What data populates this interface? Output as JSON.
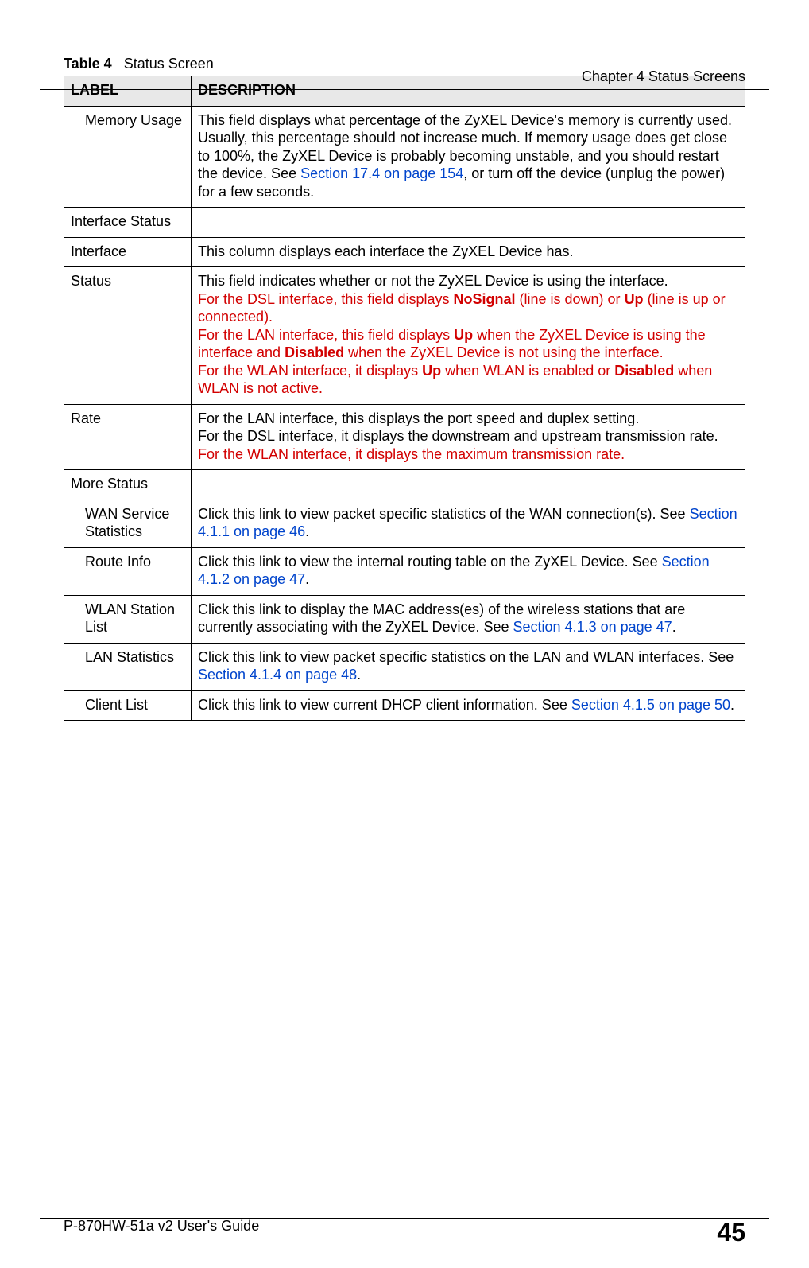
{
  "running_head": "Chapter 4 Status Screens",
  "caption_prefix": "Table 4",
  "caption_title": "Status Screen",
  "header_label": "LABEL",
  "header_desc": "DESCRIPTION",
  "rows": {
    "memory_usage": {
      "label": "Memory Usage",
      "d1": "This field displays what percentage of the ZyXEL Device's memory is currently used. Usually, this percentage should not increase much. If memory usage does get close to 100%, the ZyXEL Device is probably becoming unstable, and you should restart the device. See ",
      "link": "Section 17.4 on page 154",
      "d2": ", or turn off the device (unplug the power) for a few seconds."
    },
    "interface_status": {
      "label": "Interface Status"
    },
    "interface": {
      "label": "Interface",
      "d1": "This column displays each interface the ZyXEL Device has."
    },
    "status": {
      "label": "Status",
      "d1": "This field indicates whether or not the ZyXEL Device is using the interface.",
      "r1a": "For the DSL interface, this field displays ",
      "r1b": "NoSignal",
      "r1c": " (line is down) or ",
      "r1d": "Up",
      "r1e": " (line is up or connected).",
      "r2a": "For the LAN interface, this field displays ",
      "r2b": "Up",
      "r2c": " when the ZyXEL Device is using the interface and ",
      "r2d": "Disabled",
      "r2e": " when the ZyXEL Device is not using the interface.",
      "r3a": "For the WLAN interface, it displays ",
      "r3b": "Up",
      "r3c": " when WLAN is enabled or ",
      "r3d": "Disabled",
      "r3e": " when WLAN is not active."
    },
    "rate": {
      "label": "Rate",
      "d1": "For the LAN interface, this displays the port speed and duplex setting.",
      "d2": "For the DSL interface, it displays the downstream and upstream transmission rate.",
      "r1": "For the WLAN interface, it displays the maximum transmission rate."
    },
    "more_status": {
      "label": "More Status"
    },
    "wan_stats": {
      "label": "WAN Service Statistics",
      "d1": "Click this link to view packet specific statistics of the WAN connection(s). See ",
      "link": "Section 4.1.1 on page 46",
      "d2": "."
    },
    "route_info": {
      "label": "Route Info",
      "d1": "Click this link to view the internal routing table on the ZyXEL Device. See ",
      "link": "Section 4.1.2 on page 47",
      "d2": "."
    },
    "wlan_station": {
      "label": "WLAN Station List",
      "d1": "Click this link to display the MAC address(es) of the wireless stations that are currently associating with the ZyXEL Device. See ",
      "link": "Section 4.1.3 on page 47",
      "d2": "."
    },
    "lan_stats": {
      "label": "LAN Statistics",
      "d1": "Click this link to view packet specific statistics on the LAN and WLAN interfaces. See ",
      "link": "Section 4.1.4 on page 48",
      "d2": "."
    },
    "client_list": {
      "label": "Client List",
      "d1": "Click this link to view current DHCP client information. See ",
      "link": "Section 4.1.5 on page 50",
      "d2": "."
    }
  },
  "footer_guide": "P-870HW-51a v2 User's Guide",
  "footer_page": "45"
}
